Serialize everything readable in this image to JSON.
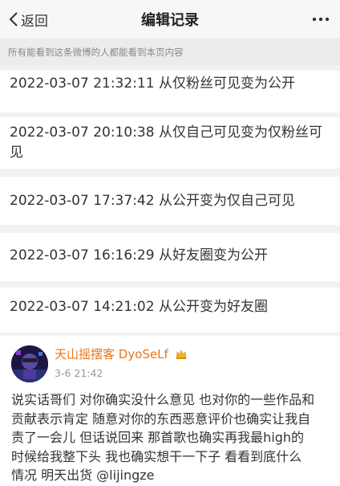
{
  "nav": {
    "back_label": "返回",
    "title": "编辑记录"
  },
  "notice": "所有能看到这条微博的人都能看到本页内容",
  "records": [
    {
      "text": "2022-03-07 21:32:11 从仅粉丝可见变为公开"
    },
    {
      "line1": "2022-03-07 20:10:38 从仅自己可见变为仅粉丝可",
      "line2": "见"
    },
    {
      "text": "2022-03-07 17:37:42 从公开变为仅自己可见"
    },
    {
      "text": "2022-03-07 16:16:29 从好友圈变为公开"
    },
    {
      "text": "2022-03-07 14:21:02 从公开变为好友圈"
    }
  ],
  "post": {
    "username": "天山摇摆客 DyoSeLf",
    "time": "3-6 21:42",
    "lines": [
      "说实话哥们 对你确实没什么意见 也对你的一些作品和",
      "贡献表示肯定 随意对你的东西恶意评价也确实让我自",
      "责了一会儿 但话说回来 那首歌也确实再我最high的",
      "时候给我整下头 我也确实想干一下子 看看到底什么",
      "情况 明天出货 @lijingze"
    ]
  },
  "icons": [
    "back-chevron-icon",
    "more-icon",
    "user-avatar",
    "vip-crown-icon"
  ],
  "colors": {
    "username": "#e8751a",
    "page_bg": "#f2f2f2",
    "notice_text": "#888888"
  }
}
